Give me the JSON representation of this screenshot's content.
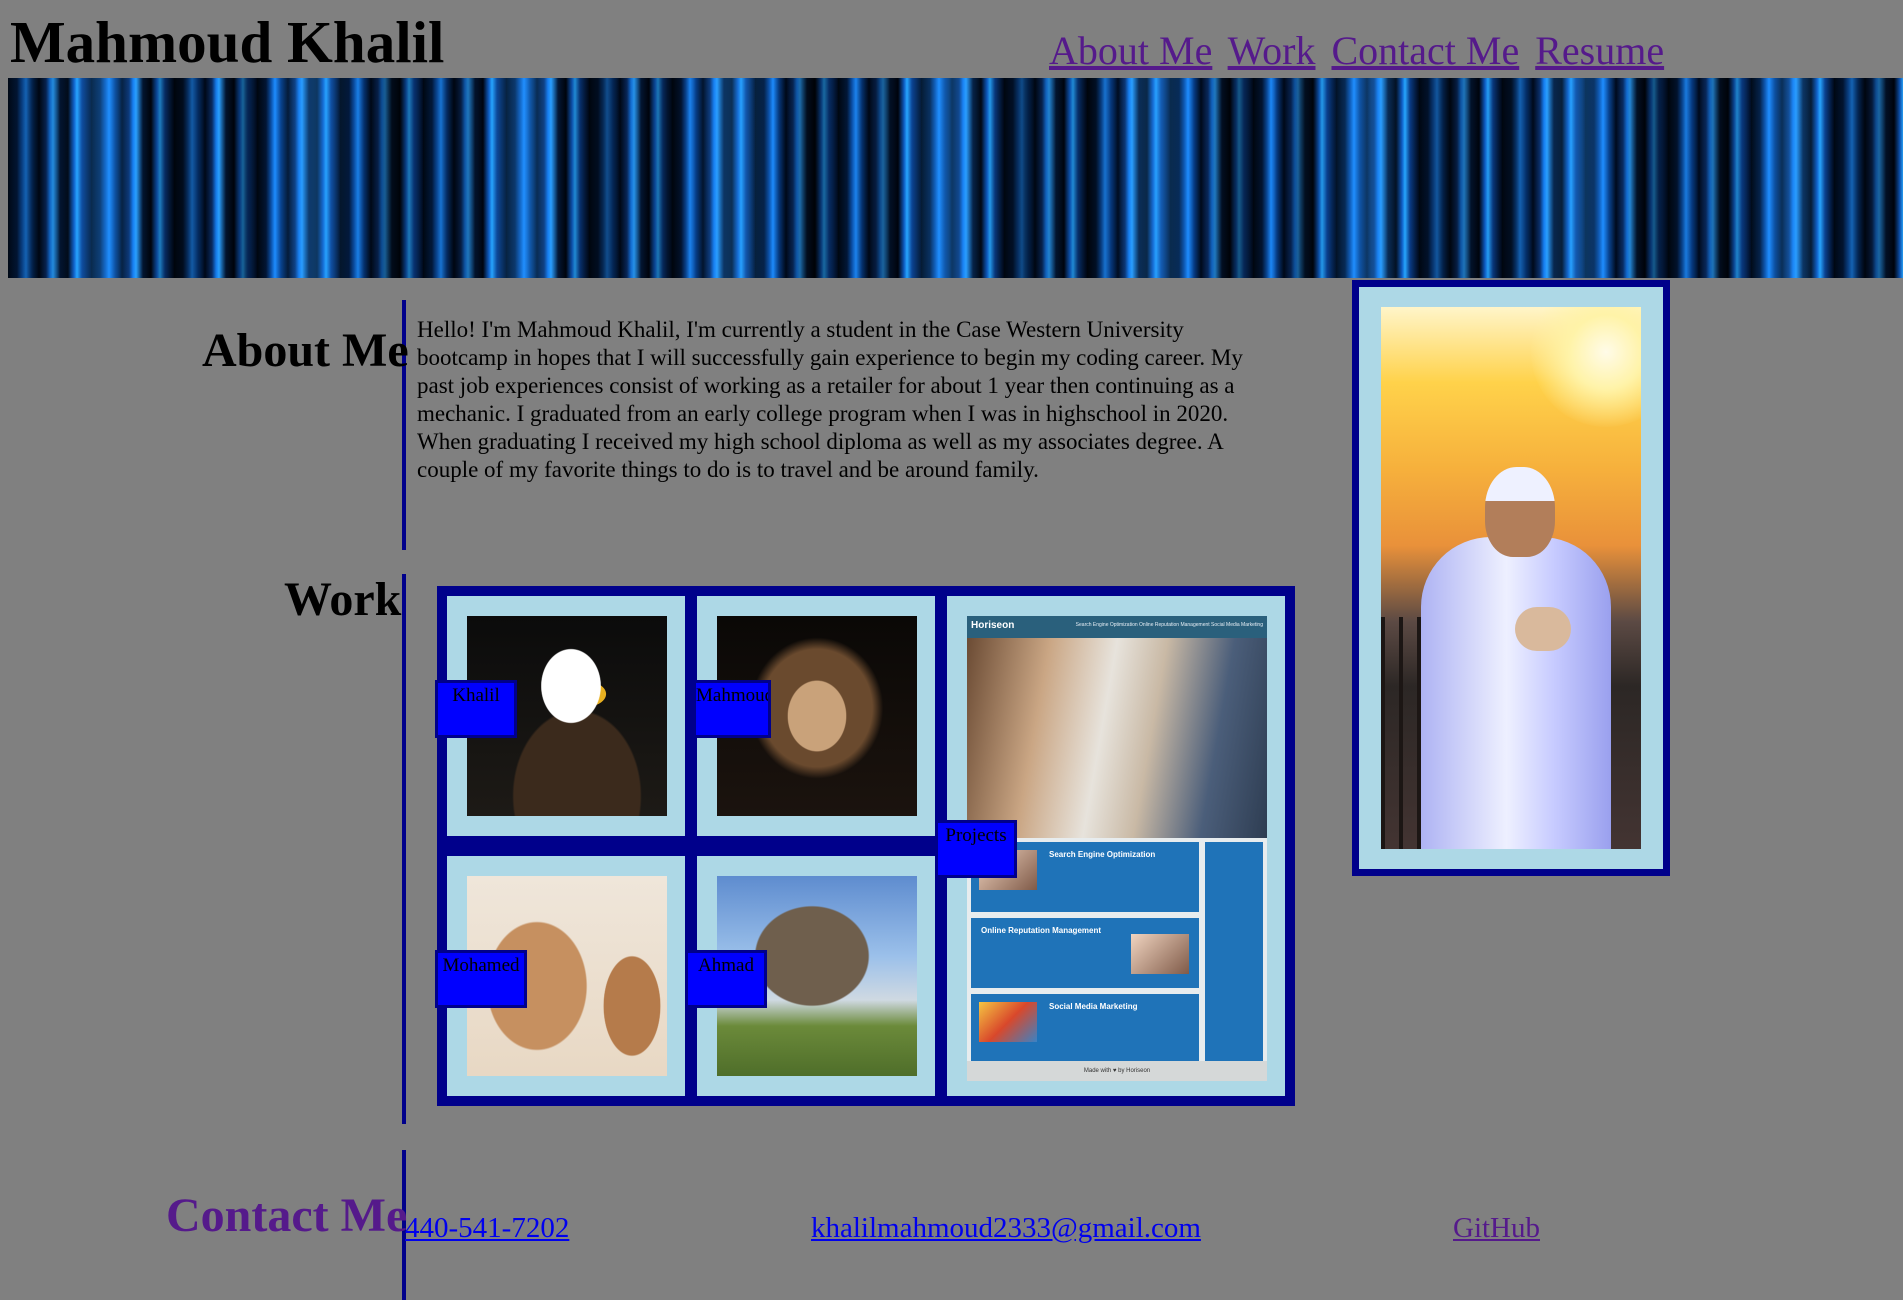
{
  "header": {
    "title": "Mahmoud Khalil",
    "nav": [
      "About Me",
      "Work",
      "Contact Me",
      "Resume"
    ]
  },
  "about": {
    "heading": "About Me",
    "text": "Hello! I'm Mahmoud Khalil, I'm currently a student in the Case Western University bootcamp in hopes that I will successfully gain experience to begin my coding career. My past job experiences consist of working as a retailer for about 1 year then continuing as a mechanic. I graduated from an early college program when I was in highschool in 2020. When graduating I received my high school diploma as well as my associates degree. A couple of my favorite things to do is to travel and be around family."
  },
  "work": {
    "heading": "Work",
    "projects": [
      {
        "label": "Khalil",
        "image": "eagle"
      },
      {
        "label": "Mahmoud",
        "image": "lion"
      },
      {
        "label": "Projects",
        "image": "horiseon-screenshot"
      },
      {
        "label": "Mohamed",
        "image": "camel"
      },
      {
        "label": "Ahmad",
        "image": "elephant"
      }
    ],
    "horiseon": {
      "brand": "Horiseon",
      "nav": "Search Engine Optimization   Online Reputation Management   Social Media Marketing",
      "sections": [
        "Search Engine Optimization",
        "Online Reputation Management",
        "Social Media Marketing"
      ],
      "footer": "Made with ♥ by Horiseon"
    }
  },
  "contact": {
    "heading": "Contact Me",
    "phone": "440-541-7202",
    "email": "khalilmahmoud2333@gmail.com",
    "github": "GitHub"
  },
  "colors": {
    "background": "#808080",
    "section_border": "#00008b",
    "card_background": "#add8e6",
    "label_background": "#0000ff",
    "visited_link": "#551a8b",
    "link": "#0000ee"
  }
}
